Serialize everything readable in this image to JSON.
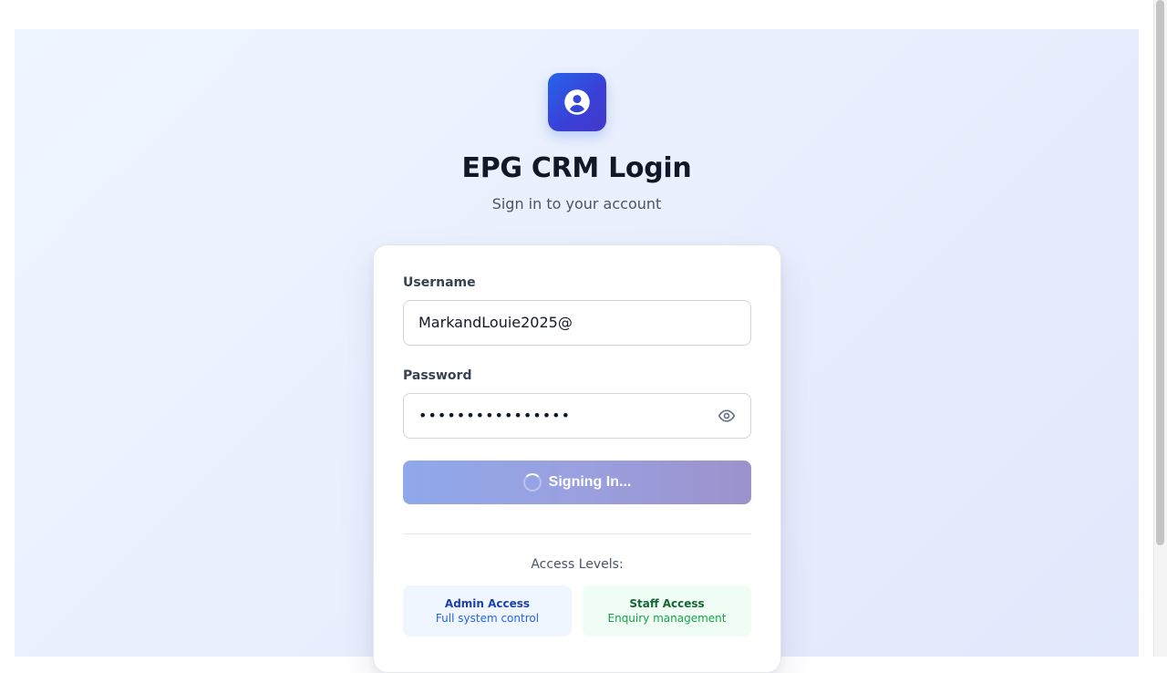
{
  "header": {
    "logo_icon": "user-circle-icon",
    "title": "EPG CRM Login",
    "subtitle": "Sign in to your account"
  },
  "form": {
    "username_label": "Username",
    "username_value": "MarkandLouie2025@",
    "password_label": "Password",
    "password_masked": "••••••••••••••••",
    "password_toggle_icon": "eye-icon",
    "submit_label": "Signing In...",
    "submit_state": "loading"
  },
  "access": {
    "title": "Access Levels:",
    "levels": [
      {
        "name": "Admin Access",
        "description": "Full system control",
        "color": "#2563eb"
      },
      {
        "name": "Staff Access",
        "description": "Enquiry management",
        "color": "#16a34a"
      }
    ]
  },
  "colors": {
    "brand": "#2563eb",
    "brand_secondary": "#4338ca",
    "title": "#111827"
  }
}
